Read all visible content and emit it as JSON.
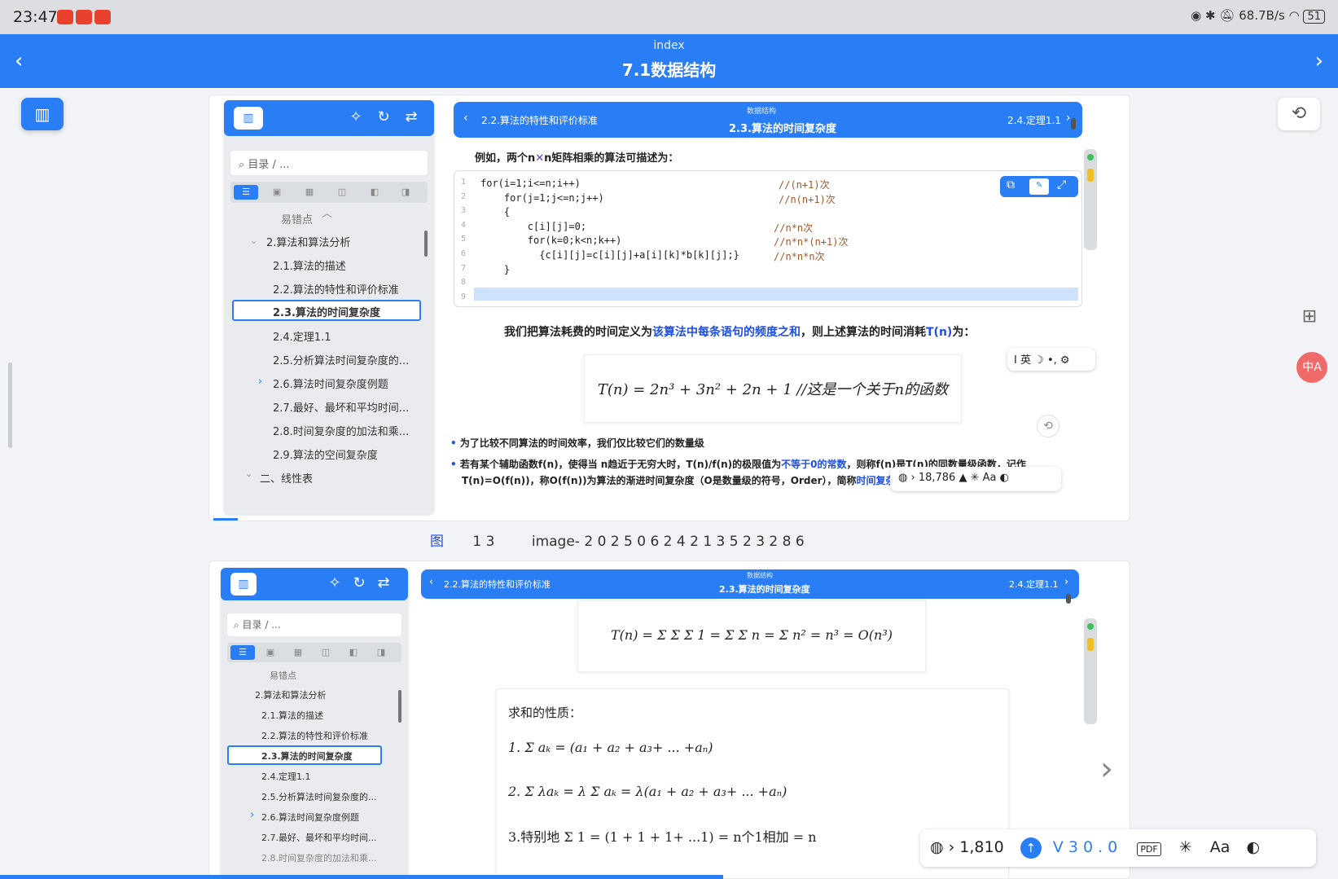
{
  "status": {
    "time": "23:47",
    "net": "68.7B/s",
    "battery": "51"
  },
  "topbar": {
    "subtitle": "index",
    "title": "7.1数据结构",
    "back": "‹",
    "forward": "›"
  },
  "left": {
    "map_icon": "map-icon"
  },
  "right": {
    "history_icon": "history-icon",
    "grid_icon": "grid-add-icon",
    "translate_icon": "translate-icon"
  },
  "shot1": {
    "sidebar": {
      "search": "目录 / ...",
      "pre": "易错点",
      "toc": [
        "2.算法和算法分析",
        "2.1.算法的描述",
        "2.2.算法的特性和评价标准",
        "2.3.算法的时间复杂度",
        "2.4.定理1.1",
        "2.5.分析算法时间复杂度的...",
        "2.6.算法时间复杂度例题",
        "2.7.最好、最坏和平均时间...",
        "2.8.时间复杂度的加法和乘...",
        "2.9.算法的空间复杂度",
        "二、线性表"
      ]
    },
    "bar": {
      "prev": "2.2.算法的特性和评价标准",
      "crumb": "数据结构",
      "current": "2.3.算法的时间复杂度",
      "next": "2.4.定理1.1"
    },
    "intro": "例如，两个n",
    "intro_x": "✕",
    "intro2": "n矩阵相乘的算法可描述为：",
    "code": [
      {
        "n": "1",
        "src": "for(i=1;i<=n;i++)",
        "cm": "//(n+1)次"
      },
      {
        "n": "2",
        "src": "    for(j=1;j<=n;j++)",
        "cm": "//n(n+1)次"
      },
      {
        "n": "3",
        "src": "    {",
        "cm": ""
      },
      {
        "n": "4",
        "src": "        c[i][j]=0;",
        "cm": "//n*n次"
      },
      {
        "n": "5",
        "src": "        for(k=0;k<n;k++)",
        "cm": "//n*n*(n+1)次"
      },
      {
        "n": "6",
        "src": "          {c[i][j]=c[i][j]+a[i][k]*b[k][j];}",
        "cm": "//n*n*n次"
      },
      {
        "n": "7",
        "src": "    }",
        "cm": ""
      },
      {
        "n": "8",
        "src": "",
        "cm": ""
      },
      {
        "n": "9",
        "src": "",
        "cm": ""
      }
    ],
    "def_a": "我们把算法耗费的时间定义为",
    "def_b": "该算法中每条语句的频度之和",
    "def_c": "，则上述算法的时间消耗",
    "def_d": "T(n)",
    "def_e": "为：",
    "formula": "T(n) = 2n³ + 3n² + 2n + 1   //这是一个关于n的函数",
    "b1": "为了比较不同算法的时间效率，我们仅比较它们的数量级",
    "b2a": "若有某个辅助函数f(n)，使得当 n趋近于无穷大时，T(n)/f(n)的极限值为",
    "b2b": "不等于0的常数",
    "b2c": "，则称f(n)是T(n)的同数量级函数，记作",
    "b3a": "T(n)=O(f(n))，称O(f(n))为算法的渐进时间复杂度（O是数量级的符号，Order），简称",
    "b3b": "时间复杂",
    "ime": {
      "mode": "英"
    },
    "count": "18,786"
  },
  "caption": {
    "fig": "图",
    "num": "1 3",
    "name": "image- 2 0 2 5 0 6 2 4 2 1 3 5 2 3 2 8 6"
  },
  "shot2": {
    "sidebar": {
      "search": "目录 / ...",
      "pre": "易错点",
      "toc": [
        "2.算法和算法分析",
        "2.1.算法的描述",
        "2.2.算法的特性和评价标准",
        "2.3.算法的时间复杂度",
        "2.4.定理1.1",
        "2.5.分析算法时间复杂度的...",
        "2.6.算法时间复杂度例题",
        "2.7.最好、最坏和平均时间...",
        "2.8.时间复杂度的加法和乘..."
      ]
    },
    "bar": {
      "prev": "2.2.算法的特性和评价标准",
      "crumb": "数据结构",
      "current": "2.3.算法的时间复杂度",
      "next": "2.4.定理1.1"
    },
    "formula": "T(n) = Σ Σ Σ 1 = Σ Σ n = Σ n² = n³ = O(n³)",
    "props_title": "求和的性质：",
    "p1": "1. Σ aₖ = (a₁ + a₂ + a₃+ ... +aₙ)",
    "p2": "2. Σ λaₖ = λ Σ aₖ = λ(a₁ + a₂ + a₃+ ... +aₙ)",
    "p3": "3.特别地 Σ 1 = (1 + 1 + 1+ ...1) = n个1相加 = n"
  },
  "bottombar": {
    "count": "1,810",
    "version": "V 3 0 . 0",
    "pdf": "PDF"
  }
}
